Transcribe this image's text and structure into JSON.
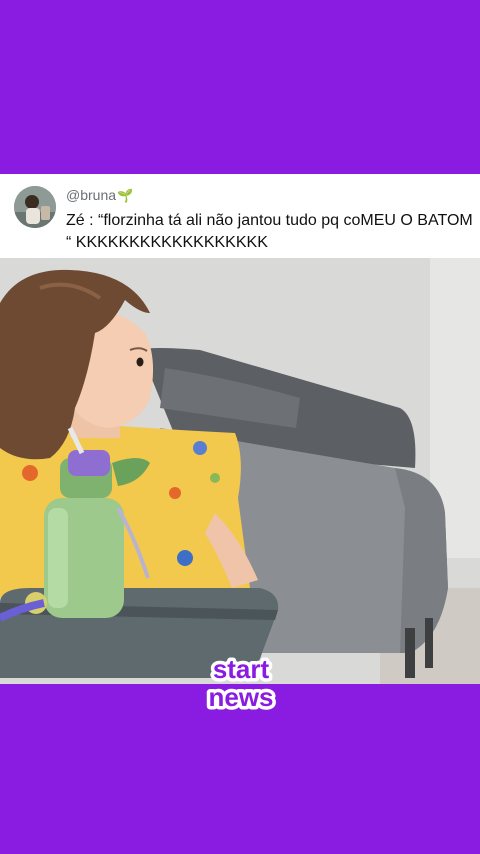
{
  "post": {
    "handle": "@bruna",
    "handle_emoji": "🌱",
    "text": "Zé : “florzinha tá ali não jantou tudo pq coMEU O BATOM “ KKKKKKKKKKKKKKKKKK"
  },
  "brand": {
    "logo_line1": "start",
    "logo_line2": "news"
  },
  "colors": {
    "background": "#8a1be0",
    "card": "#ffffff",
    "logo_fill": "#8a1be0"
  },
  "icons": {
    "handle_emoji": "sprout-icon"
  }
}
